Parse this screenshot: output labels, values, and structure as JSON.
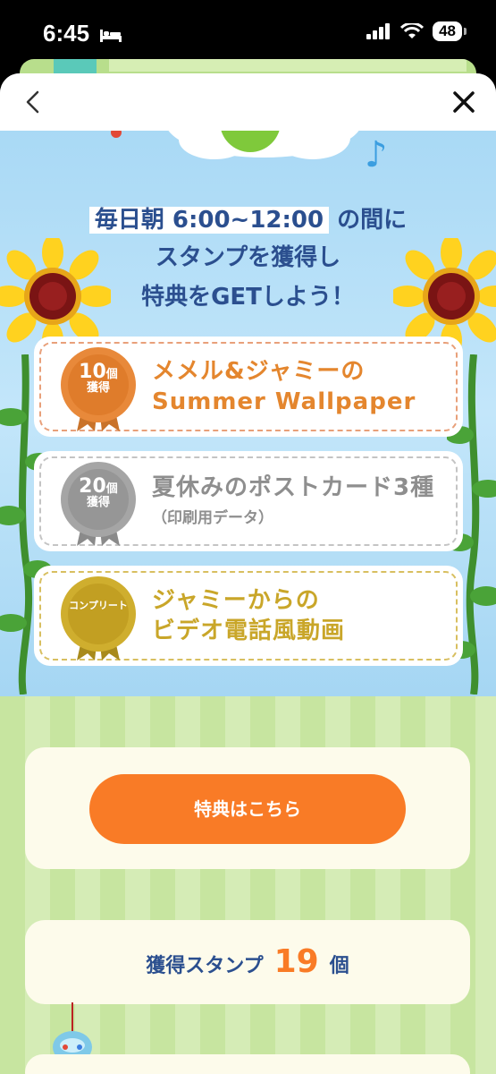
{
  "status": {
    "time": "6:45",
    "battery": "48"
  },
  "headline": {
    "hilite": "毎日朝 6:00~12:00",
    "line1_rest": " の間に",
    "line2": "スタンプを獲得し",
    "line3": "特典をGETしよう！"
  },
  "rewards": [
    {
      "badge_num": "10",
      "badge_unit": "個",
      "badge_sub": "獲得",
      "line1": "メメル&ジャミーの",
      "line2": "Summer Wallpaper"
    },
    {
      "badge_num": "20",
      "badge_unit": "個",
      "badge_sub": "獲得",
      "line1": "夏休みのポストカード3種",
      "note": "（印刷用データ）"
    },
    {
      "badge_label": "コンプリート",
      "line1": "ジャミーからの",
      "line2": "ビデオ電話風動画"
    }
  ],
  "reward_button": "特典はこちら",
  "stamps": {
    "label": "獲得スタンプ",
    "count": "19",
    "unit": "個"
  },
  "colors": {
    "orange": "#f97b26",
    "navy": "#2b4f8f",
    "sky": "#a9d9f5",
    "green_stripe": "#c7e5a0"
  },
  "icons": [
    "bed-icon",
    "signal-icon",
    "wifi-icon",
    "battery-icon",
    "back-chevron-icon",
    "close-icon",
    "sunflower-icon",
    "music-note-icon"
  ]
}
